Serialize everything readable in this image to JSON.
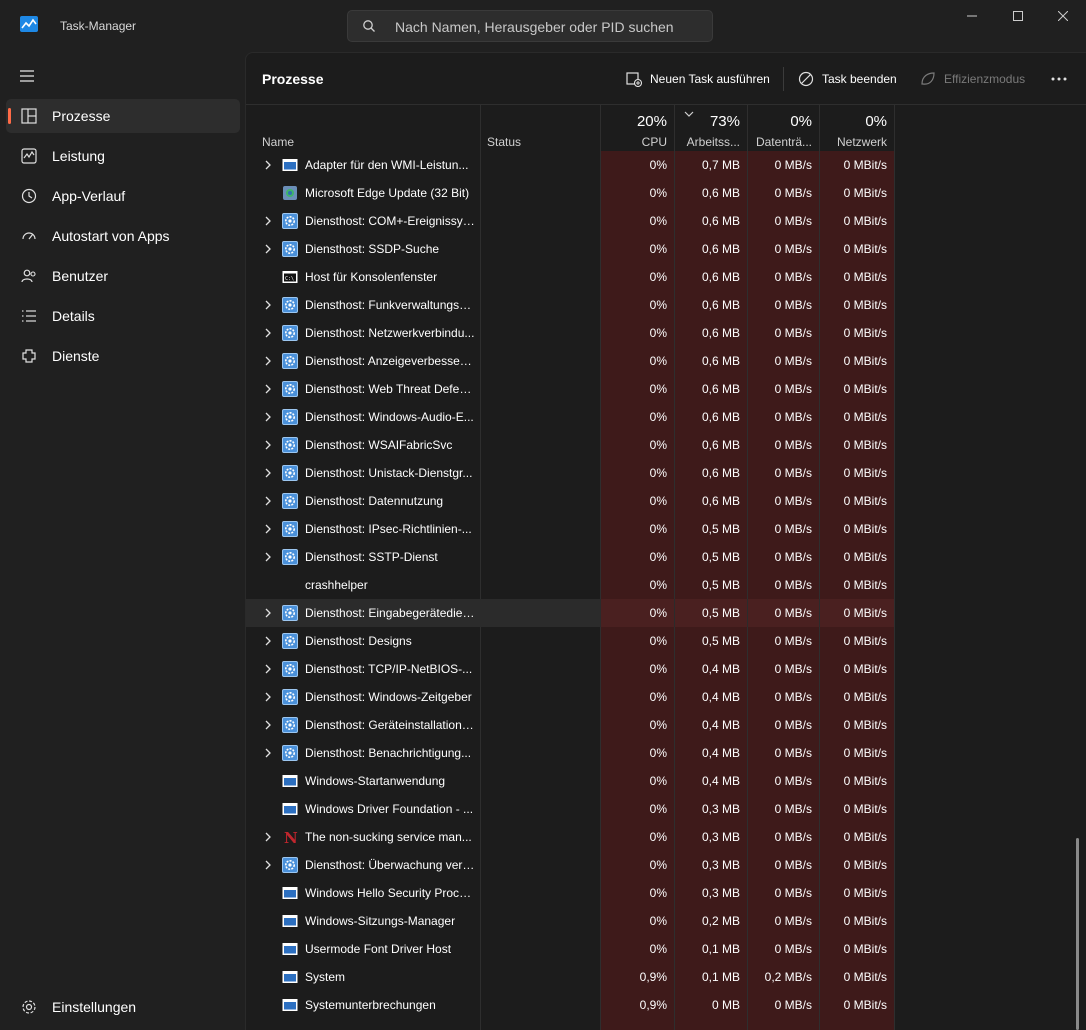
{
  "window": {
    "title": "Task-Manager"
  },
  "search": {
    "placeholder": "Nach Namen, Herausgeber oder PID suchen"
  },
  "nav": {
    "items": [
      {
        "label": "Prozesse",
        "icon": "processes-icon",
        "active": true
      },
      {
        "label": "Leistung",
        "icon": "performance-icon"
      },
      {
        "label": "App-Verlauf",
        "icon": "history-icon"
      },
      {
        "label": "Autostart von Apps",
        "icon": "startup-icon"
      },
      {
        "label": "Benutzer",
        "icon": "users-icon"
      },
      {
        "label": "Details",
        "icon": "details-icon"
      },
      {
        "label": "Dienste",
        "icon": "services-icon"
      }
    ],
    "settings_label": "Einstellungen"
  },
  "toolbar": {
    "page_title": "Prozesse",
    "new_task": "Neuen Task ausführen",
    "end_task": "Task beenden",
    "efficiency": "Effizienzmodus"
  },
  "columns": {
    "name": "Name",
    "status": "Status",
    "cpu": {
      "pct": "20%",
      "label": "CPU"
    },
    "memory": {
      "pct": "73%",
      "label": "Arbeitss..."
    },
    "disk": {
      "pct": "0%",
      "label": "Datenträ..."
    },
    "network": {
      "pct": "0%",
      "label": "Netzwerk"
    }
  },
  "processes": [
    {
      "name": "Adapter für den WMI-Leistun...",
      "expand": true,
      "icon": "window-app-icon",
      "cpu": "0%",
      "mem": "0,7 MB",
      "disk": "0 MB/s",
      "net": "0 MBit/s"
    },
    {
      "name": "Microsoft Edge Update (32 Bit)",
      "expand": false,
      "icon": "edge-update-icon",
      "cpu": "0%",
      "mem": "0,6 MB",
      "disk": "0 MB/s",
      "net": "0 MBit/s"
    },
    {
      "name": "Diensthost: COM+-Ereignissys...",
      "expand": true,
      "icon": "service-gear-icon",
      "cpu": "0%",
      "mem": "0,6 MB",
      "disk": "0 MB/s",
      "net": "0 MBit/s"
    },
    {
      "name": "Diensthost: SSDP-Suche",
      "expand": true,
      "icon": "service-gear-icon",
      "cpu": "0%",
      "mem": "0,6 MB",
      "disk": "0 MB/s",
      "net": "0 MBit/s"
    },
    {
      "name": "Host für Konsolenfenster",
      "expand": false,
      "icon": "console-icon",
      "cpu": "0%",
      "mem": "0,6 MB",
      "disk": "0 MB/s",
      "net": "0 MBit/s"
    },
    {
      "name": "Diensthost: Funkverwaltungsd...",
      "expand": true,
      "icon": "service-gear-icon",
      "cpu": "0%",
      "mem": "0,6 MB",
      "disk": "0 MB/s",
      "net": "0 MBit/s"
    },
    {
      "name": "Diensthost: Netzwerkverbindu...",
      "expand": true,
      "icon": "service-gear-icon",
      "cpu": "0%",
      "mem": "0,6 MB",
      "disk": "0 MB/s",
      "net": "0 MBit/s"
    },
    {
      "name": "Diensthost: Anzeigeverbesseru...",
      "expand": true,
      "icon": "service-gear-icon",
      "cpu": "0%",
      "mem": "0,6 MB",
      "disk": "0 MB/s",
      "net": "0 MBit/s"
    },
    {
      "name": "Diensthost: Web Threat Defen...",
      "expand": true,
      "icon": "service-gear-icon",
      "cpu": "0%",
      "mem": "0,6 MB",
      "disk": "0 MB/s",
      "net": "0 MBit/s"
    },
    {
      "name": "Diensthost: Windows-Audio-E...",
      "expand": true,
      "icon": "service-gear-icon",
      "cpu": "0%",
      "mem": "0,6 MB",
      "disk": "0 MB/s",
      "net": "0 MBit/s"
    },
    {
      "name": "Diensthost: WSAIFabricSvc",
      "expand": true,
      "icon": "service-gear-icon",
      "cpu": "0%",
      "mem": "0,6 MB",
      "disk": "0 MB/s",
      "net": "0 MBit/s"
    },
    {
      "name": "Diensthost: Unistack-Dienstgr...",
      "expand": true,
      "icon": "service-gear-icon",
      "cpu": "0%",
      "mem": "0,6 MB",
      "disk": "0 MB/s",
      "net": "0 MBit/s"
    },
    {
      "name": "Diensthost: Datennutzung",
      "expand": true,
      "icon": "service-gear-icon",
      "cpu": "0%",
      "mem": "0,6 MB",
      "disk": "0 MB/s",
      "net": "0 MBit/s"
    },
    {
      "name": "Diensthost: IPsec-Richtlinien-...",
      "expand": true,
      "icon": "service-gear-icon",
      "cpu": "0%",
      "mem": "0,5 MB",
      "disk": "0 MB/s",
      "net": "0 MBit/s"
    },
    {
      "name": "Diensthost: SSTP-Dienst",
      "expand": true,
      "icon": "service-gear-icon",
      "cpu": "0%",
      "mem": "0,5 MB",
      "disk": "0 MB/s",
      "net": "0 MBit/s"
    },
    {
      "name": "crashhelper",
      "expand": false,
      "icon": "none",
      "cpu": "0%",
      "mem": "0,5 MB",
      "disk": "0 MB/s",
      "net": "0 MBit/s"
    },
    {
      "name": "Diensthost: Eingabegerätedienst",
      "expand": true,
      "icon": "service-gear-icon",
      "cpu": "0%",
      "mem": "0,5 MB",
      "disk": "0 MB/s",
      "net": "0 MBit/s",
      "highlighted": true
    },
    {
      "name": "Diensthost: Designs",
      "expand": true,
      "icon": "service-gear-icon",
      "cpu": "0%",
      "mem": "0,5 MB",
      "disk": "0 MB/s",
      "net": "0 MBit/s"
    },
    {
      "name": "Diensthost: TCP/IP-NetBIOS-...",
      "expand": true,
      "icon": "service-gear-icon",
      "cpu": "0%",
      "mem": "0,4 MB",
      "disk": "0 MB/s",
      "net": "0 MBit/s"
    },
    {
      "name": "Diensthost: Windows-Zeitgeber",
      "expand": true,
      "icon": "service-gear-icon",
      "cpu": "0%",
      "mem": "0,4 MB",
      "disk": "0 MB/s",
      "net": "0 MBit/s"
    },
    {
      "name": "Diensthost: Geräteinstallations...",
      "expand": true,
      "icon": "service-gear-icon",
      "cpu": "0%",
      "mem": "0,4 MB",
      "disk": "0 MB/s",
      "net": "0 MBit/s"
    },
    {
      "name": "Diensthost: Benachrichtigung...",
      "expand": true,
      "icon": "service-gear-icon",
      "cpu": "0%",
      "mem": "0,4 MB",
      "disk": "0 MB/s",
      "net": "0 MBit/s"
    },
    {
      "name": "Windows-Startanwendung",
      "expand": false,
      "icon": "window-app-icon",
      "cpu": "0%",
      "mem": "0,4 MB",
      "disk": "0 MB/s",
      "net": "0 MBit/s"
    },
    {
      "name": "Windows Driver Foundation - ...",
      "expand": false,
      "icon": "window-app-icon",
      "cpu": "0%",
      "mem": "0,3 MB",
      "disk": "0 MB/s",
      "net": "0 MBit/s"
    },
    {
      "name": "The non-sucking service man...",
      "expand": true,
      "icon": "nssm-icon",
      "cpu": "0%",
      "mem": "0,3 MB",
      "disk": "0 MB/s",
      "net": "0 MBit/s"
    },
    {
      "name": "Diensthost: Überwachung vert...",
      "expand": true,
      "icon": "service-gear-icon",
      "cpu": "0%",
      "mem": "0,3 MB",
      "disk": "0 MB/s",
      "net": "0 MBit/s"
    },
    {
      "name": "Windows Hello Security Process",
      "expand": false,
      "icon": "window-app-icon",
      "cpu": "0%",
      "mem": "0,3 MB",
      "disk": "0 MB/s",
      "net": "0 MBit/s"
    },
    {
      "name": "Windows-Sitzungs-Manager",
      "expand": false,
      "icon": "window-app-icon",
      "cpu": "0%",
      "mem": "0,2 MB",
      "disk": "0 MB/s",
      "net": "0 MBit/s"
    },
    {
      "name": "Usermode Font Driver Host",
      "expand": false,
      "icon": "window-app-icon",
      "cpu": "0%",
      "mem": "0,1 MB",
      "disk": "0 MB/s",
      "net": "0 MBit/s"
    },
    {
      "name": "System",
      "expand": false,
      "icon": "window-app-icon",
      "cpu": "0,9%",
      "mem": "0,1 MB",
      "disk": "0,2 MB/s",
      "net": "0 MBit/s"
    },
    {
      "name": "Systemunterbrechungen",
      "expand": false,
      "icon": "window-app-icon",
      "cpu": "0,9%",
      "mem": "0 MB",
      "disk": "0 MB/s",
      "net": "0 MBit/s"
    }
  ],
  "colors": {
    "accent": "#ff6b47",
    "heat_cell": "#3e1a1a",
    "background": "#202020"
  }
}
